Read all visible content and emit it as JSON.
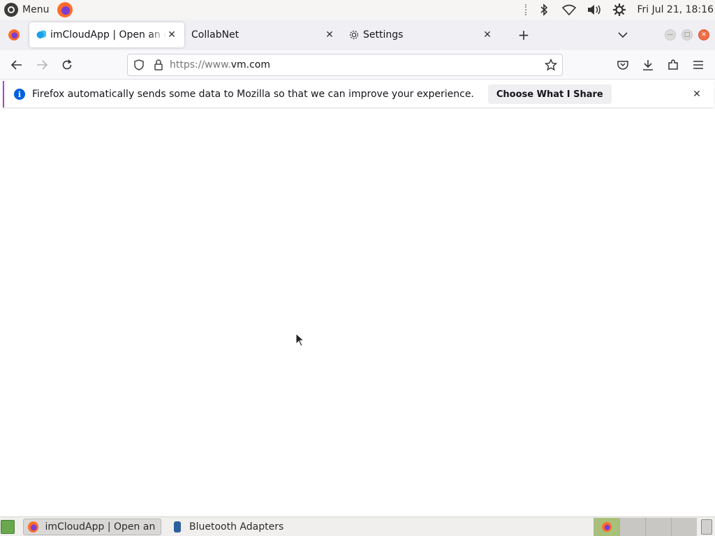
{
  "system_panel": {
    "menu_label": "Menu",
    "clock": "Fri Jul 21, 18:16",
    "tray_icons": [
      "bluetooth-icon",
      "wifi-icon",
      "volume-icon",
      "settings-gear-icon"
    ]
  },
  "tabs": [
    {
      "title": "imCloudApp | Open an easy",
      "active": true
    },
    {
      "title": "CollabNet",
      "active": false
    },
    {
      "title": "Settings",
      "active": false
    }
  ],
  "navigation": {
    "url_prefix": "https://www.",
    "url_host": "vm.com"
  },
  "notification": {
    "message": "Firefox automatically sends some data to Mozilla so that we can improve your experience.",
    "button_label": "Choose What I Share",
    "accent_color": "#b040e0",
    "info_color": "#0060df"
  },
  "taskbar": {
    "items": [
      {
        "label": "imCloudApp | Open an ...",
        "active": true
      },
      {
        "label": "Bluetooth Adapters",
        "active": false
      }
    ]
  }
}
